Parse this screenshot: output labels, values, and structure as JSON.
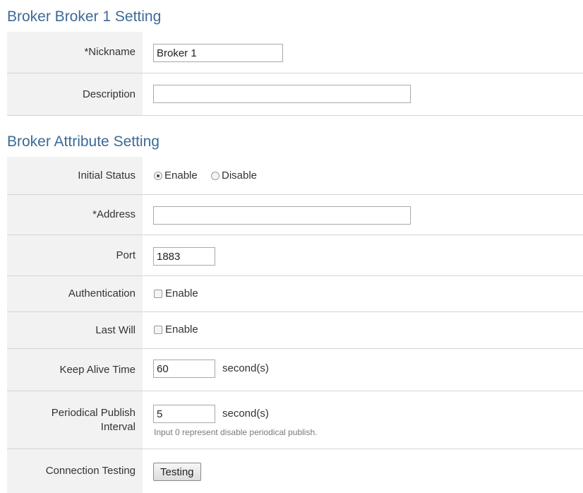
{
  "broker_section": {
    "title": "Broker Broker 1 Setting",
    "nickname_label": "*Nickname",
    "nickname_value": "Broker 1",
    "description_label": "Description",
    "description_value": ""
  },
  "attribute_section": {
    "title": "Broker Attribute Setting",
    "initial_status_label": "Initial Status",
    "initial_status_options": [
      "Enable",
      "Disable"
    ],
    "initial_status_selected": "Enable",
    "address_label": "*Address",
    "address_value": "",
    "port_label": "Port",
    "port_value": "1883",
    "authentication_label": "Authentication",
    "authentication_option": "Enable",
    "authentication_checked": false,
    "last_will_label": "Last Will",
    "last_will_option": "Enable",
    "last_will_checked": false,
    "keep_alive_label": "Keep Alive Time",
    "keep_alive_value": "60",
    "keep_alive_unit": "second(s)",
    "publish_interval_label_line1": "Periodical Publish",
    "publish_interval_label_line2": "Interval",
    "publish_interval_value": "5",
    "publish_interval_unit": "second(s)",
    "publish_interval_hint": "Input 0 represent disable periodical publish.",
    "connection_testing_label": "Connection Testing",
    "testing_button_label": "Testing"
  },
  "colors": {
    "section_title": "#3c6a96",
    "label_background": "#f2f2f2",
    "row_divider": "#d4d4d4"
  }
}
